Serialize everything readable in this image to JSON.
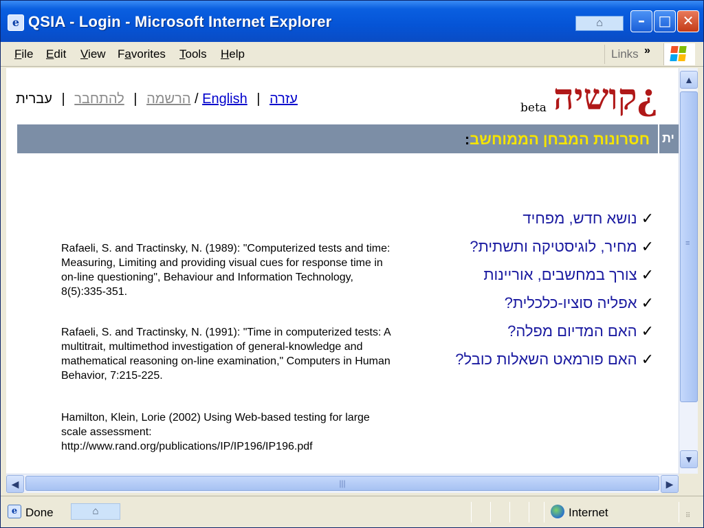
{
  "window": {
    "title": "QSIA - Login - Microsoft Internet Explorer",
    "min_glyph": "–",
    "max_glyph": "□",
    "close_glyph": "✕"
  },
  "menu": {
    "items": [
      {
        "label": "File",
        "accel": "F",
        "rest": "ile"
      },
      {
        "label": "Edit",
        "accel": "E",
        "rest": "dit"
      },
      {
        "label": "View",
        "accel": "V",
        "rest": "iew"
      },
      {
        "label": "Favorites",
        "pre": "F",
        "accel": "a",
        "rest": "vorites"
      },
      {
        "label": "Tools",
        "accel": "T",
        "rest": "ools"
      },
      {
        "label": "Help",
        "accel": "H",
        "rest": "elp"
      }
    ],
    "links_label": "Links",
    "links_chevron": "»"
  },
  "page": {
    "top_links": {
      "register": "הרשמה",
      "login": "להתחבר",
      "hebrew": "עברית",
      "slash": "/",
      "english": "English",
      "help": "עזרה",
      "divider": "|"
    },
    "logo": {
      "text": "קושיה",
      "mark": "¿",
      "beta": "beta"
    },
    "banner": {
      "title": "חסרונות המבחן הממוחשב",
      "colon": ":",
      "corner_fragment": "ית"
    },
    "checklist": [
      "נושא חדש, מפחיד",
      "מחיר, לוגיסטיקה ותשתית?",
      "צורך במחשבים, אוריינות",
      "אפליה סוציו-כלכלית?",
      "האם המדיום מפלה?",
      "האם פורמאט השאלות כובל?"
    ],
    "check_glyph": "✓",
    "references": [
      "Rafaeli, S. and Tractinsky, N. (1989): \"Computerized tests and time: Measuring, Limiting and providing visual cues for response time in on-line questioning\", Behaviour and Information Technology, 8(5):335-351.",
      "Rafaeli, S. and Tractinsky, N. (1991): \"Time in computerized tests: A multitrait, multimethod investigation of general-knowledge and mathematical reasoning on-line examination,\" Computers in Human Behavior, 7:215-225.",
      "Hamilton, Klein, Lorie (2002) Using Web-based testing for large scale assessment: http://www.rand.org/publications/IP/IP196/IP196.pdf"
    ]
  },
  "status": {
    "text": "Done",
    "zone": "Internet"
  },
  "colors": {
    "titlebar": "#0554d6",
    "banner": "#7c8ea6",
    "banner_text": "#f5e400",
    "link": "#0000cc",
    "checklist_text": "#1a1aa0",
    "logo": "#b01818"
  },
  "icons": {
    "title": "ie-page-icon",
    "home": "home-icon",
    "windows_logo": "windows-flag-icon",
    "scroll_up": "arrow-up-icon",
    "scroll_down": "arrow-down-icon",
    "scroll_left": "arrow-left-icon",
    "scroll_right": "arrow-right-icon",
    "zone": "globe-icon"
  }
}
